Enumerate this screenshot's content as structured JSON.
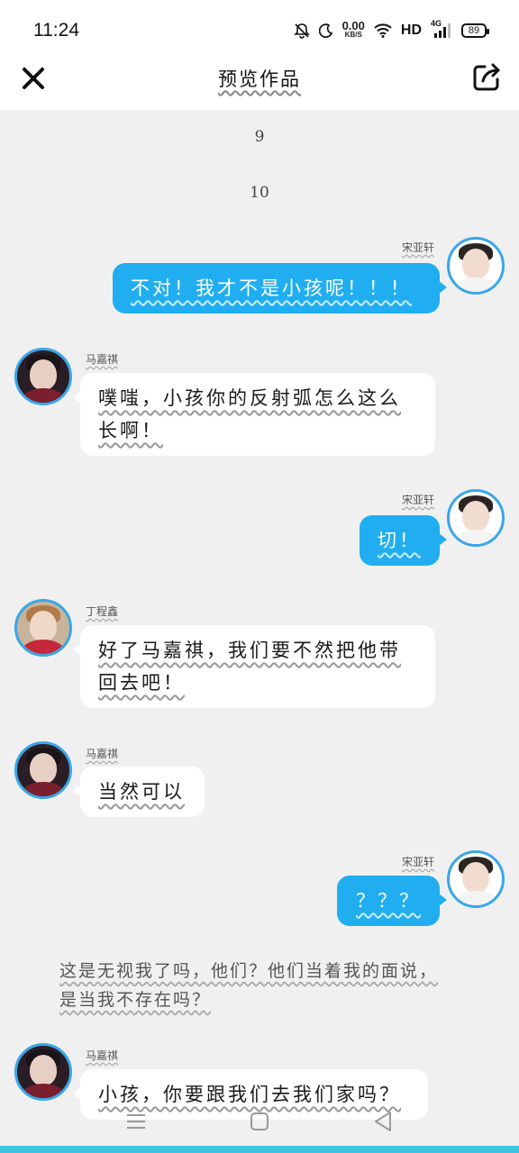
{
  "status_bar": {
    "time": "11:24",
    "speed_value": "0.00",
    "speed_unit": "KB/S",
    "hd": "HD",
    "network": "4G",
    "battery": "89"
  },
  "header": {
    "title": "预览作品"
  },
  "separators": [
    "9",
    "10"
  ],
  "messages": [
    {
      "side": "right",
      "name": "宋亚轩",
      "text": "不对！我才不是小孩呢！！！"
    },
    {
      "side": "left",
      "name": "马嘉祺",
      "text": "噗嗤，小孩你的反射弧怎么这么长啊！"
    },
    {
      "side": "right",
      "name": "宋亚轩",
      "text": "切！"
    },
    {
      "side": "left",
      "name": "丁程鑫",
      "text": "好了马嘉祺，我们要不然把他带回去吧！"
    },
    {
      "side": "left",
      "name": "马嘉祺",
      "text": "当然可以"
    },
    {
      "side": "right",
      "name": "宋亚轩",
      "text": "？？？"
    },
    {
      "side": "left",
      "name": "马嘉祺",
      "text": "小孩，你要跟我们去我们家吗？"
    }
  ],
  "narration": "这是无视我了吗，他们？他们当着我的面说，是当我不存在吗？",
  "colors": {
    "accent": "#20aef0",
    "avatar_ring": "#3aa6e8",
    "background": "#f0f0f0",
    "bottom_strip": "#3ec6e0"
  },
  "icons": [
    "close-icon",
    "share-icon",
    "mute-icon",
    "moon-icon",
    "wifi-icon",
    "signal-icon",
    "menu-icon",
    "home-icon",
    "back-icon"
  ]
}
